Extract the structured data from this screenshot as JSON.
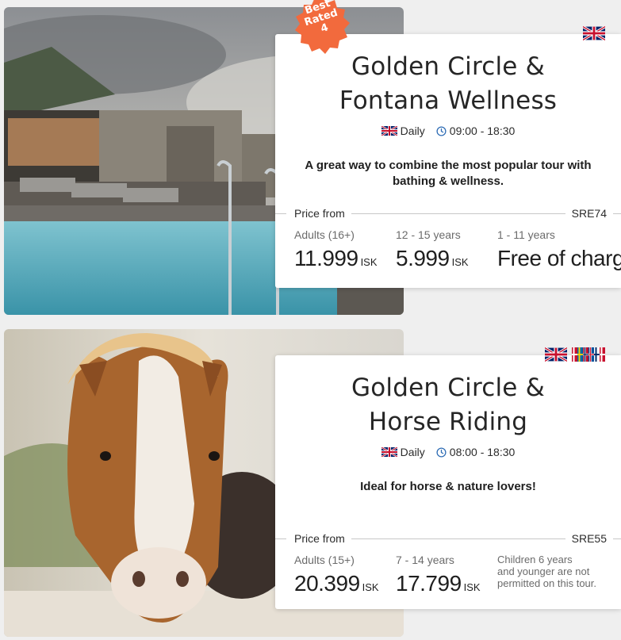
{
  "tours": [
    {
      "badge": {
        "line1": "Best",
        "line2": "Rated",
        "number": "4"
      },
      "flags": [
        "uk-flag-icon"
      ],
      "title_line1": "Golden Circle &",
      "title_line2": "Fontana Wellness",
      "schedule_frequency": "Daily",
      "schedule_time": "09:00 - 18:30",
      "description": "A great way to combine the most popular tour with bathing & wellness.",
      "price_label": "Price from",
      "code": "SRE74",
      "prices": [
        {
          "age": "Adults (16+)",
          "amount": "11.999",
          "currency": "ISK"
        },
        {
          "age": "12 - 15 years",
          "amount": "5.999",
          "currency": "ISK"
        },
        {
          "age": "1 - 11 years",
          "amount": "Free of charge",
          "currency": ""
        }
      ]
    },
    {
      "flags": [
        "uk-flag-icon",
        "nordic-flags-icon"
      ],
      "title_line1": "Golden Circle &",
      "title_line2": "Horse Riding",
      "schedule_frequency": "Daily",
      "schedule_time": "08:00 - 18:30",
      "description": "Ideal for horse & nature lovers!",
      "price_label": "Price from",
      "code": "SRE55",
      "prices": [
        {
          "age": "Adults (15+)",
          "amount": "20.399",
          "currency": "ISK"
        },
        {
          "age": "7 - 14 years",
          "amount": "17.799",
          "currency": "ISK"
        },
        {
          "note_line1": "Children 6 years",
          "note_line2": "and younger are not",
          "note_line3": "permitted on this tour."
        }
      ]
    }
  ],
  "colors": {
    "badge": "#f26a3d",
    "accent_icon": "#2f6db5"
  }
}
